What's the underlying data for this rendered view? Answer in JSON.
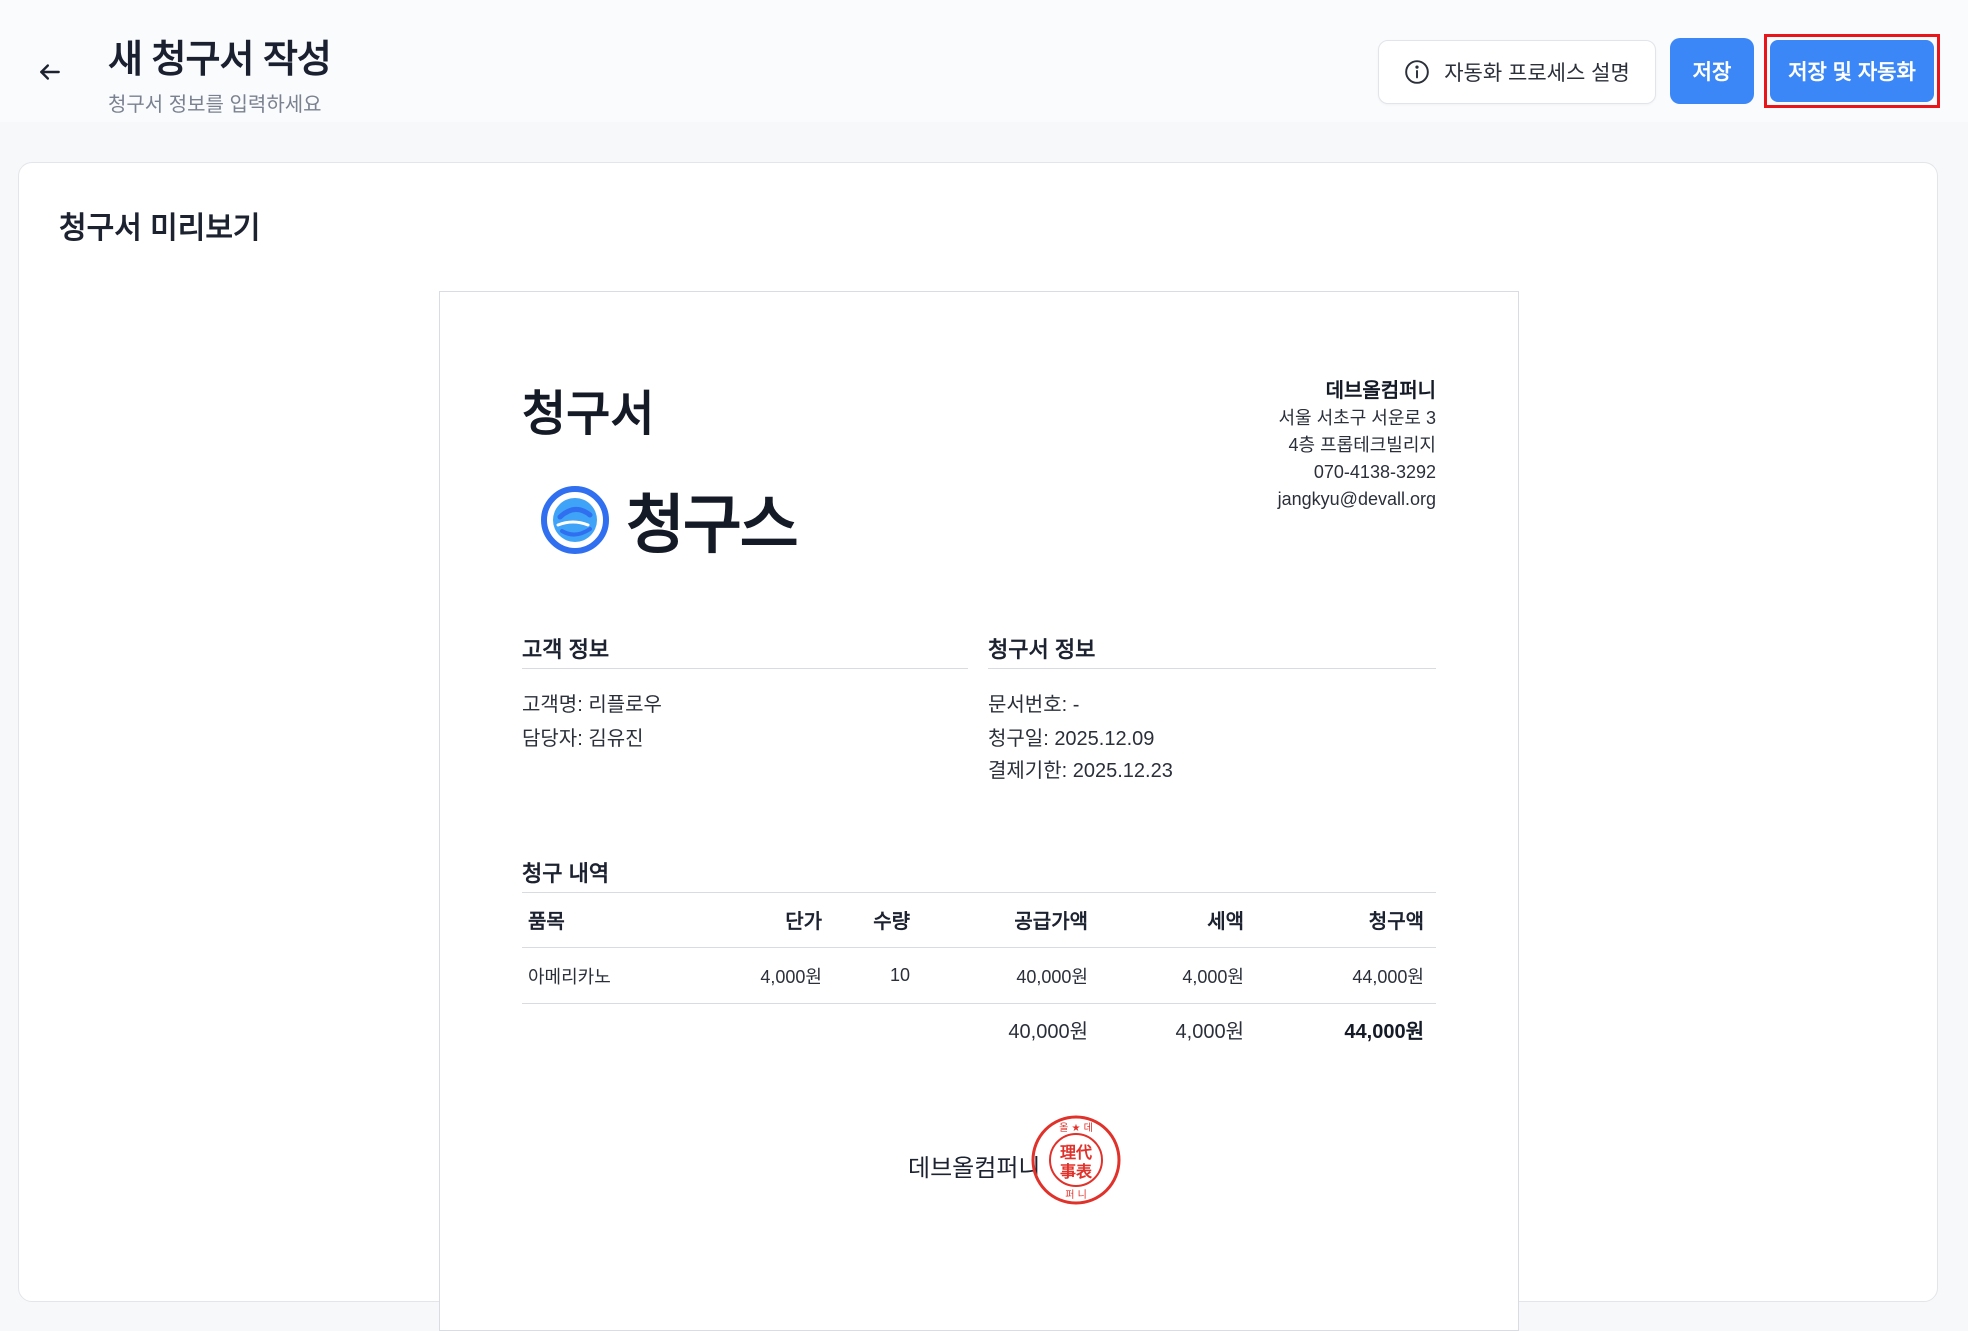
{
  "header": {
    "title": "새 청구서 작성",
    "subtitle": "청구서 정보를 입력하세요",
    "explain_label": "자동화 프로세스 설명",
    "save_label": "저장",
    "save_auto_label": "저장 및 자동화"
  },
  "preview": {
    "title": "청구서 미리보기",
    "invoice_title": "청구서",
    "logo_text": "청구스",
    "company": {
      "name": "데브올컴퍼니",
      "address1": "서울 서초구 서운로 3",
      "address2": "4층 프롭테크빌리지",
      "phone": "070-4138-3292",
      "email": "jangkyu@devall.org"
    },
    "customer": {
      "section_title": "고객 정보",
      "name_line": "고객명: 리플로우",
      "manager_line": "담당자: 김유진"
    },
    "invoice_info": {
      "section_title": "청구서 정보",
      "doc_no_line": "문서번호: -",
      "date_line": "청구일: 2025.12.09",
      "due_line": "결제기한: 2025.12.23"
    },
    "billing": {
      "section_title": "청구 내역",
      "headers": [
        "품목",
        "단가",
        "수량",
        "공급가액",
        "세액",
        "청구액"
      ],
      "rows": [
        [
          "아메리카노",
          "4,000원",
          "10",
          "40,000원",
          "4,000원",
          "44,000원"
        ]
      ],
      "totals": {
        "supply": "40,000원",
        "tax": "4,000원",
        "total": "44,000원"
      }
    },
    "signature_company": "데브올컴퍼니",
    "stamp_text": "理代事表"
  },
  "colors": {
    "primary": "#3b87f7",
    "highlight_border": "#e8161b",
    "stamp_red": "#e0312a"
  }
}
